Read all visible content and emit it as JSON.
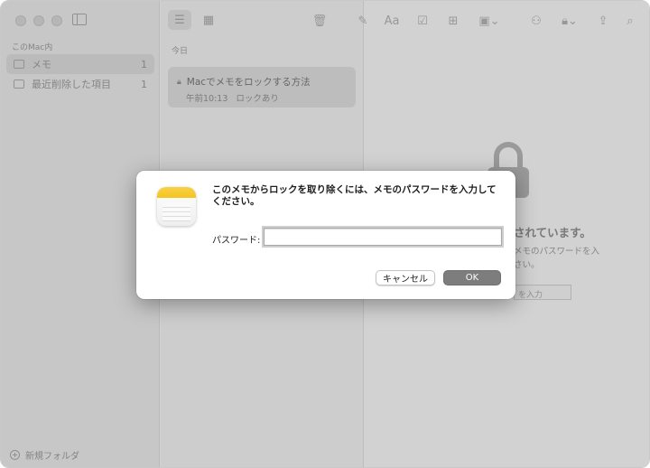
{
  "sidebar": {
    "section_label": "このMac内",
    "items": [
      {
        "label": "メモ",
        "count": "1",
        "icon": "folder-icon"
      },
      {
        "label": "最近削除した項目",
        "count": "1",
        "icon": "trash-folder-icon"
      }
    ],
    "new_folder_label": "新規フォルダ"
  },
  "list": {
    "date_header": "今日",
    "notes": [
      {
        "title": "Macでメモをロックする方法",
        "time": "午前10:13",
        "status": "ロックあり"
      }
    ]
  },
  "editor": {
    "locked_heading": "されています。",
    "locked_desc_line1": "メモのパスワードを入",
    "locked_desc_line2": "さい。",
    "locked_field_text": "を入力"
  },
  "dialog": {
    "message": "このメモからロックを取り除くには、メモのパスワードを入力してください。",
    "password_label": "パスワード:",
    "password_value": "",
    "cancel_label": "キャンセル",
    "ok_label": "OK"
  },
  "toolbar": {
    "format_label": "Aa"
  }
}
